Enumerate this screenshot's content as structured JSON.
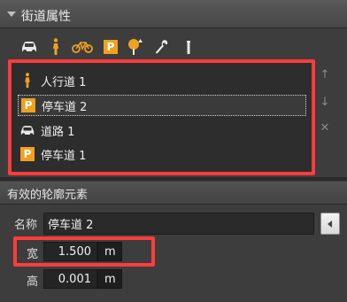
{
  "street_panel": {
    "title": "街道属性",
    "toolbar": {
      "icons": [
        "car-icon",
        "pedestrian-icon",
        "bicycle-icon",
        "parking-icon",
        "tree-icon",
        "wrench-icon",
        "bollard-icon"
      ],
      "parking_glyph": "P"
    },
    "lane_list": [
      {
        "icon": "pedestrian-icon",
        "label": "人行道 1",
        "selected": false
      },
      {
        "icon": "parking-icon",
        "label": "停车道 2",
        "selected": true
      },
      {
        "icon": "car-icon",
        "label": "道路 1",
        "selected": false
      },
      {
        "icon": "parking-icon",
        "label": "停车道 1",
        "selected": false
      }
    ],
    "side_buttons": {
      "up": "↑",
      "down": "↓",
      "remove": "✕"
    }
  },
  "contour_panel": {
    "title": "有效的轮廓元素",
    "name_label": "名称",
    "name_value": "停车道 2",
    "width_label": "宽",
    "width_value": "1.500",
    "width_unit": "m",
    "height_label": "高",
    "height_value": "0.001",
    "height_unit": "m"
  },
  "colors": {
    "highlight": "#ff3b3b",
    "parking_badge": "#f0a11e",
    "pedestrian": "#f0a11e",
    "bicycle": "#f0a11e",
    "tree_top": "#f0a11e"
  }
}
